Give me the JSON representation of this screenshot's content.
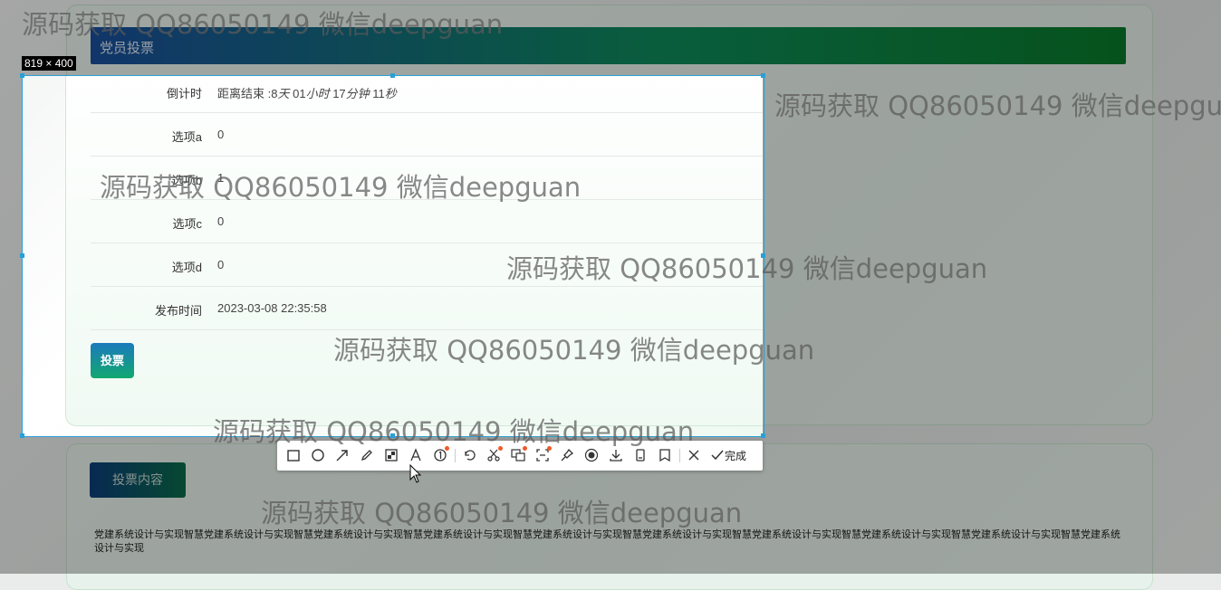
{
  "panel": {
    "title": "党员投票"
  },
  "selection": {
    "size_label": "819 × 400"
  },
  "vote": {
    "rows": [
      {
        "label": "倒计时",
        "prefix": "距离结束 :8",
        "d": "天",
        "n1": " 01",
        "h": "小时",
        "n2": " 17",
        "m": "分钟",
        "n3": " 11",
        "s": "秒"
      },
      {
        "label": "选项a",
        "value": "0"
      },
      {
        "label": "选项b",
        "value": "1"
      },
      {
        "label": "选项c",
        "value": "0"
      },
      {
        "label": "选项d",
        "value": "0"
      },
      {
        "label": "发布时间",
        "value": "2023-03-08 22:35:58"
      }
    ],
    "vote_button": "投票"
  },
  "toolbar": {
    "tools": [
      "rectangle-icon",
      "ellipse-icon",
      "arrow-icon",
      "pencil-icon",
      "mosaic-icon",
      "text-icon",
      "number-icon",
      "undo-icon",
      "cutout-icon",
      "translate-icon",
      "long-screenshot-icon",
      "pin-icon",
      "record-icon",
      "download-icon",
      "save-device-icon",
      "bookmark-icon",
      "close-icon"
    ],
    "done_label": "完成"
  },
  "content": {
    "button": "投票内容",
    "text": "党建系统设计与实现智慧党建系统设计与实现智慧党建系统设计与实现智慧党建系统设计与实现智慧党建系统设计与实现智慧党建系统设计与实现智慧党建系统设计与实现智慧党建系统设计与实现智慧党建系统设计与实现智慧党建系统设计与实现"
  },
  "watermark": {
    "text": "源码获取 QQ86050149 微信deepguan"
  },
  "colors": {
    "accent": "#2a9fd6",
    "header_start": "#1a4f9c",
    "header_end": "#0a7a2a",
    "button_green": "#12a870"
  }
}
